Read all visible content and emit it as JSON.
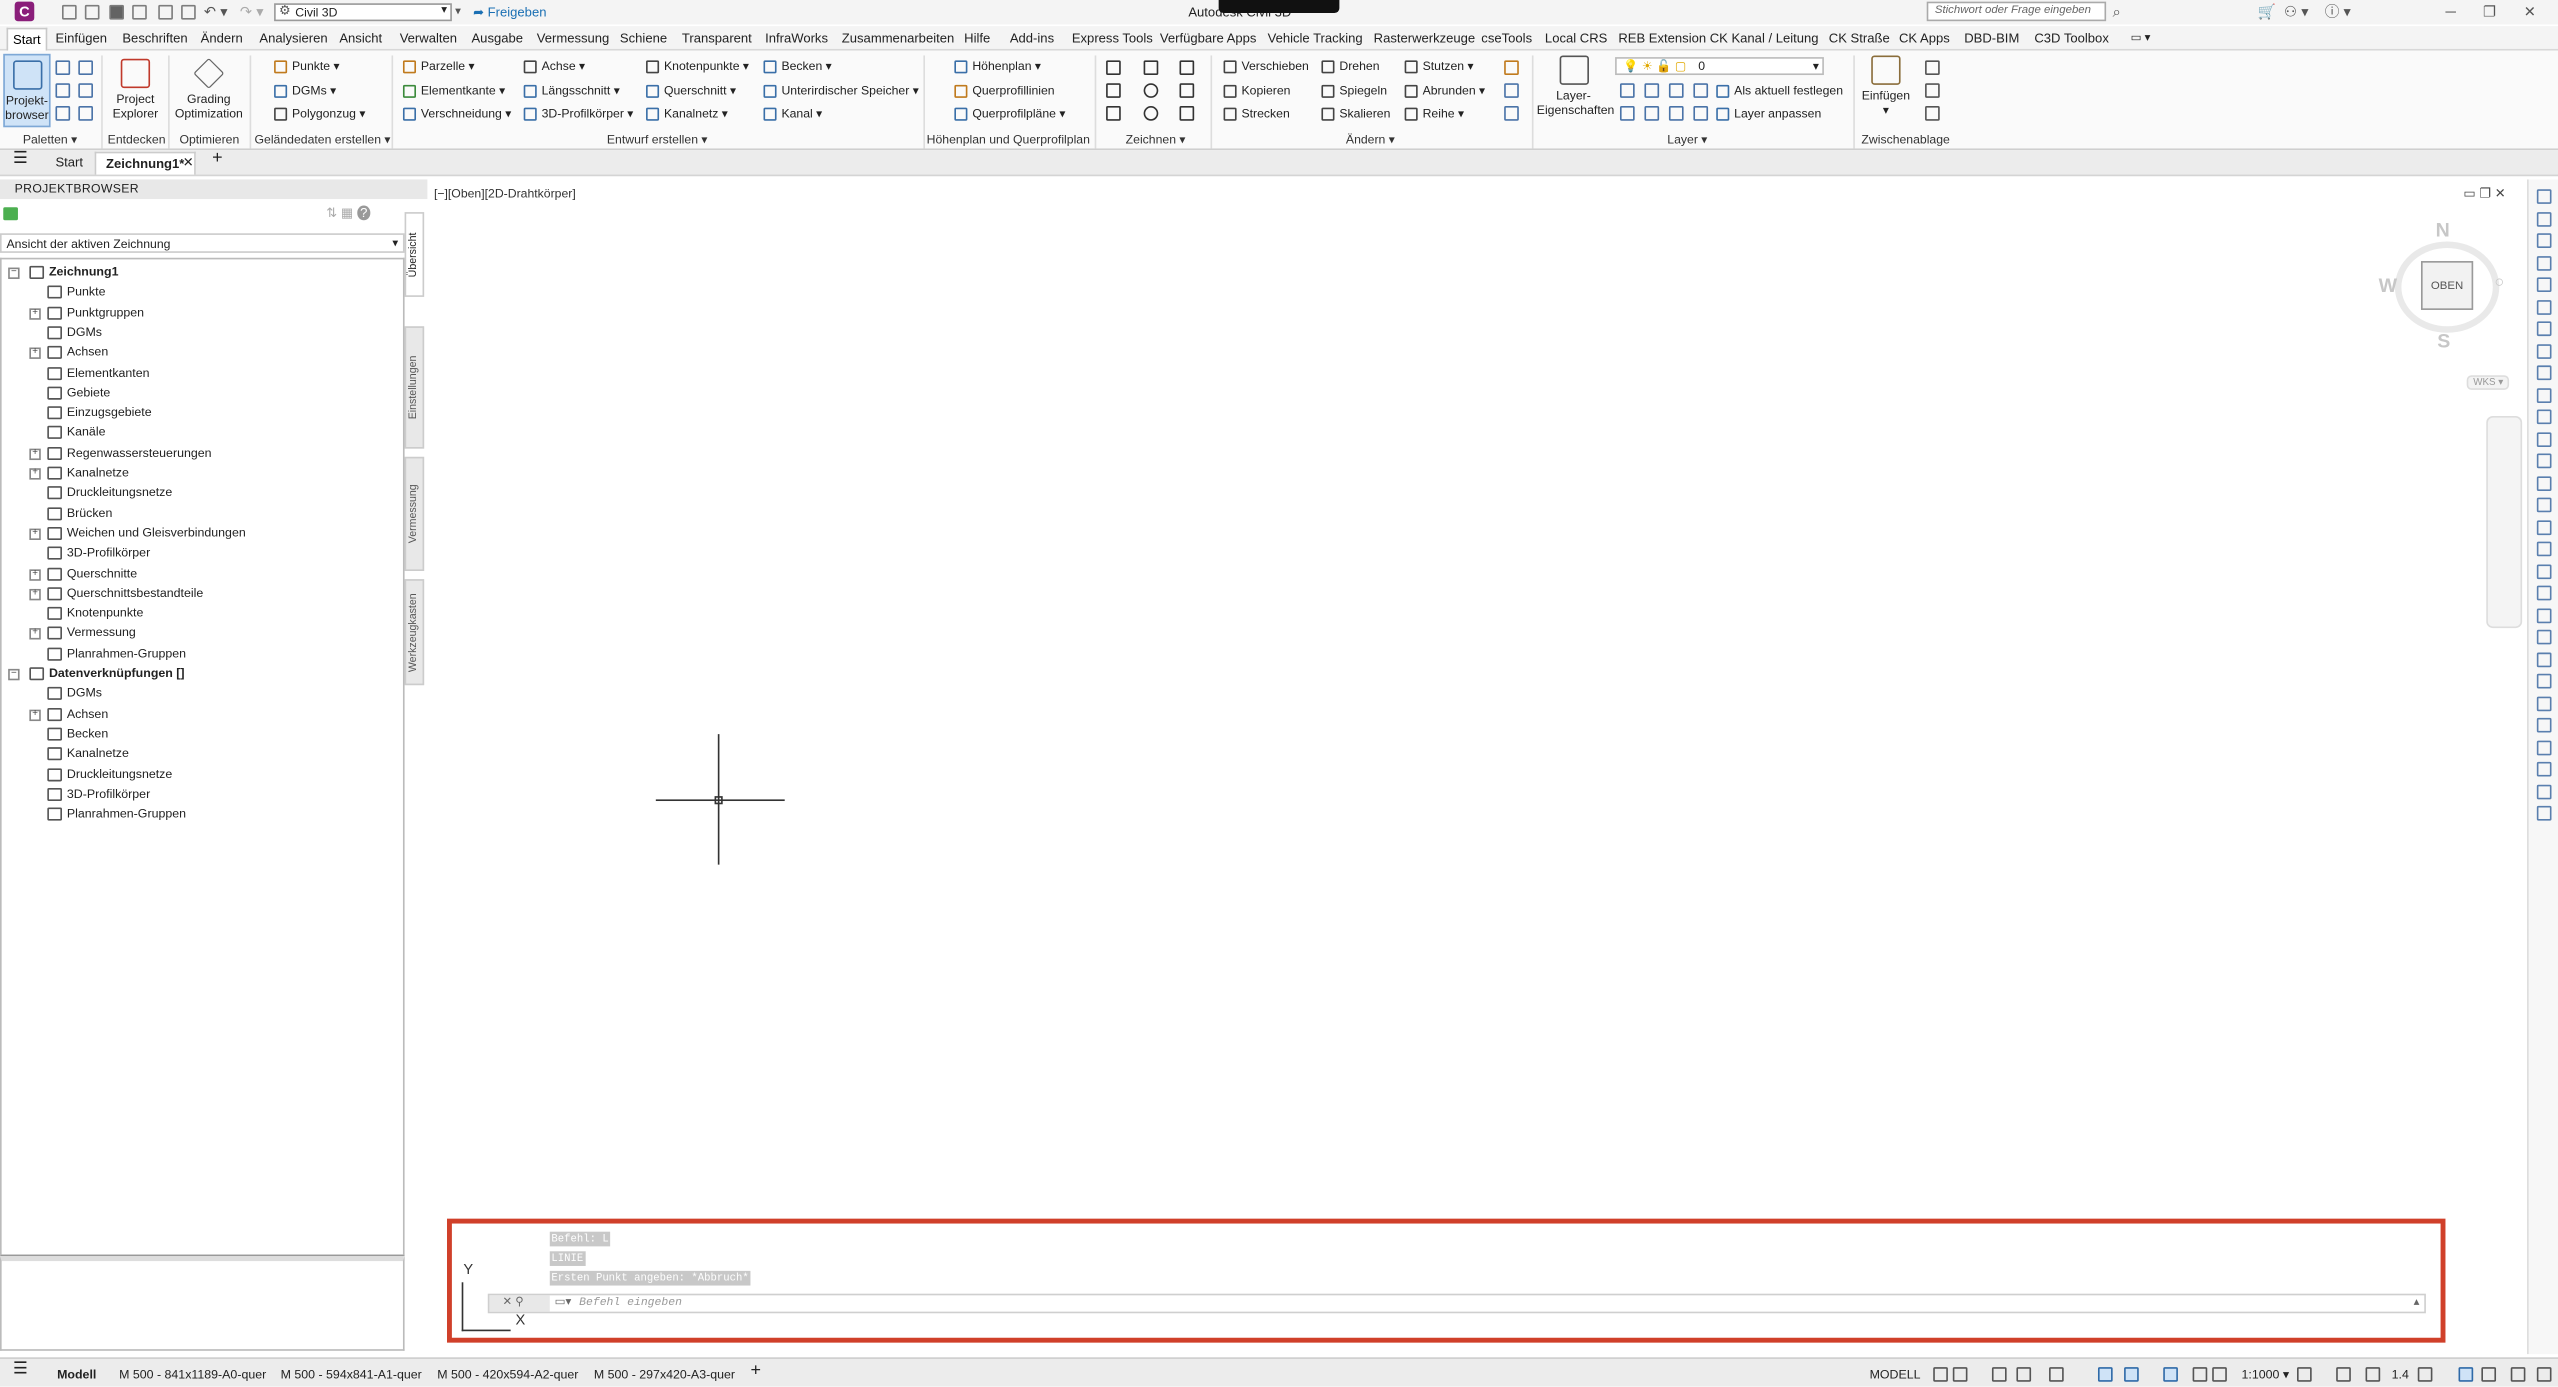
{
  "titlebar": {
    "app_icon": "C",
    "workspace": "Civil 3D",
    "share": "Freigeben",
    "title": "Autodesk Civil 3D",
    "search_placeholder": "Stichwort oder Frage eingeben"
  },
  "menu_tabs": [
    "Start",
    "Einfügen",
    "Beschriften",
    "Ändern",
    "Analysieren",
    "Ansicht",
    "Verwalten",
    "Ausgabe",
    "Vermessung",
    "Schiene",
    "Transparent",
    "InfraWorks",
    "Zusammenarbeiten",
    "Hilfe",
    "Add-ins",
    "Express Tools",
    "Verfügbare Apps",
    "Vehicle Tracking",
    "Rasterwerkzeuge",
    "cseTools",
    "Local CRS",
    "REB Extension",
    "CK Kanal / Leitung",
    "CK Straße",
    "CK Apps",
    "DBD-BIM",
    "C3D Toolbox"
  ],
  "ribbon": {
    "paletten": {
      "label": "Paletten",
      "projektbrowser": "Projekt-\nbrowser"
    },
    "entdecken": {
      "label": "Entdecken",
      "project_explorer": "Project\nExplorer"
    },
    "optimieren": {
      "label": "Optimieren",
      "grading": "Grading\nOptimization"
    },
    "gelaende": {
      "label": "Geländedaten erstellen",
      "punkte": "Punkte",
      "dgms": "DGMs",
      "polygonzug": "Polygonzug"
    },
    "entwurf": {
      "label": "Entwurf erstellen",
      "parzelle": "Parzelle",
      "elementkante": "Elementkante",
      "verschneidung": "Verschneidung",
      "achse": "Achse",
      "laengsschnitt": "Längsschnitt",
      "profilkoerper": "3D-Profilkörper",
      "knotenpunkte": "Knotenpunkte",
      "querschnitt": "Querschnitt",
      "kanalnetz": "Kanalnetz",
      "becken": "Becken",
      "speicher": "Unterirdischer Speicher",
      "kanal": "Kanal"
    },
    "hoehenplan": {
      "label": "Höhenplan und Querprofilplan",
      "hoehenplan": "Höhenplan",
      "querprofillinien": "Querprofillinien",
      "querprofilplaene": "Querprofilpläne"
    },
    "zeichnen": {
      "label": "Zeichnen"
    },
    "aendern": {
      "label": "Ändern",
      "verschieben": "Verschieben",
      "kopieren": "Kopieren",
      "strecken": "Strecken",
      "drehen": "Drehen",
      "spiegeln": "Spiegeln",
      "skalieren": "Skalieren",
      "stutzen": "Stutzen",
      "abrunden": "Abrunden",
      "reihe": "Reihe"
    },
    "layer": {
      "label": "Layer",
      "eigenschaften": "Layer-\nEigenschaften",
      "current": "0",
      "als_aktuell": "Als aktuell festlegen",
      "anpassen": "Layer anpassen"
    },
    "zwischenablage": {
      "label": "Zwischenablage",
      "einfuegen": "Einfügen"
    }
  },
  "doc_tabs": {
    "start": "Start",
    "active": "Zeichnung1*"
  },
  "palette": {
    "title": "PROJEKTBROWSER",
    "view_select": "Ansicht der aktiven Zeichnung",
    "side_tabs": [
      "Übersicht",
      "Einstellungen",
      "Vermessung",
      "Werkzeugkasten"
    ],
    "drawing_root": "Zeichnung1",
    "drawing_items": [
      "Punkte",
      "Punktgruppen",
      "DGMs",
      "Achsen",
      "Elementkanten",
      "Gebiete",
      "Einzugsgebiete",
      "Kanäle",
      "Regenwassersteuerungen",
      "Kanalnetze",
      "Druckleitungsnetze",
      "Brücken",
      "Weichen und Gleisverbindungen",
      "3D-Profilkörper",
      "Querschnitte",
      "Querschnittsbestandteile",
      "Knotenpunkte",
      "Vermessung",
      "Planrahmen-Gruppen"
    ],
    "data_root": "Datenverknüpfungen []",
    "data_items": [
      "DGMs",
      "Achsen",
      "Becken",
      "Kanalnetze",
      "Druckleitungsnetze",
      "3D-Profilkörper",
      "Planrahmen-Gruppen"
    ]
  },
  "viewport": {
    "label": "[−][Oben][2D-Drahtkörper]",
    "viewcube": {
      "n": "N",
      "s": "S",
      "w": "W",
      "face": "OBEN"
    },
    "wcs": "WKS ▾"
  },
  "command": {
    "history": [
      "Befehl: L",
      "LINIE",
      "Ersten Punkt angeben: *Abbruch*"
    ],
    "placeholder": "Befehl eingeben",
    "ucs_x": "X",
    "ucs_y": "Y"
  },
  "status": {
    "layouts": [
      "Modell",
      "M 500 - 841x1189-A0-quer",
      "M 500 - 594x841-A1-quer",
      "M 500 - 420x594-A2-quer",
      "M 500 - 297x420-A3-quer"
    ],
    "mode": "MODELL",
    "scale": "1:1000",
    "annoscale": "1.4"
  },
  "colors": {
    "accent": "#1a6fb3",
    "highlight_frame": "#d0402a",
    "app_icon": "#8a1e7a"
  }
}
